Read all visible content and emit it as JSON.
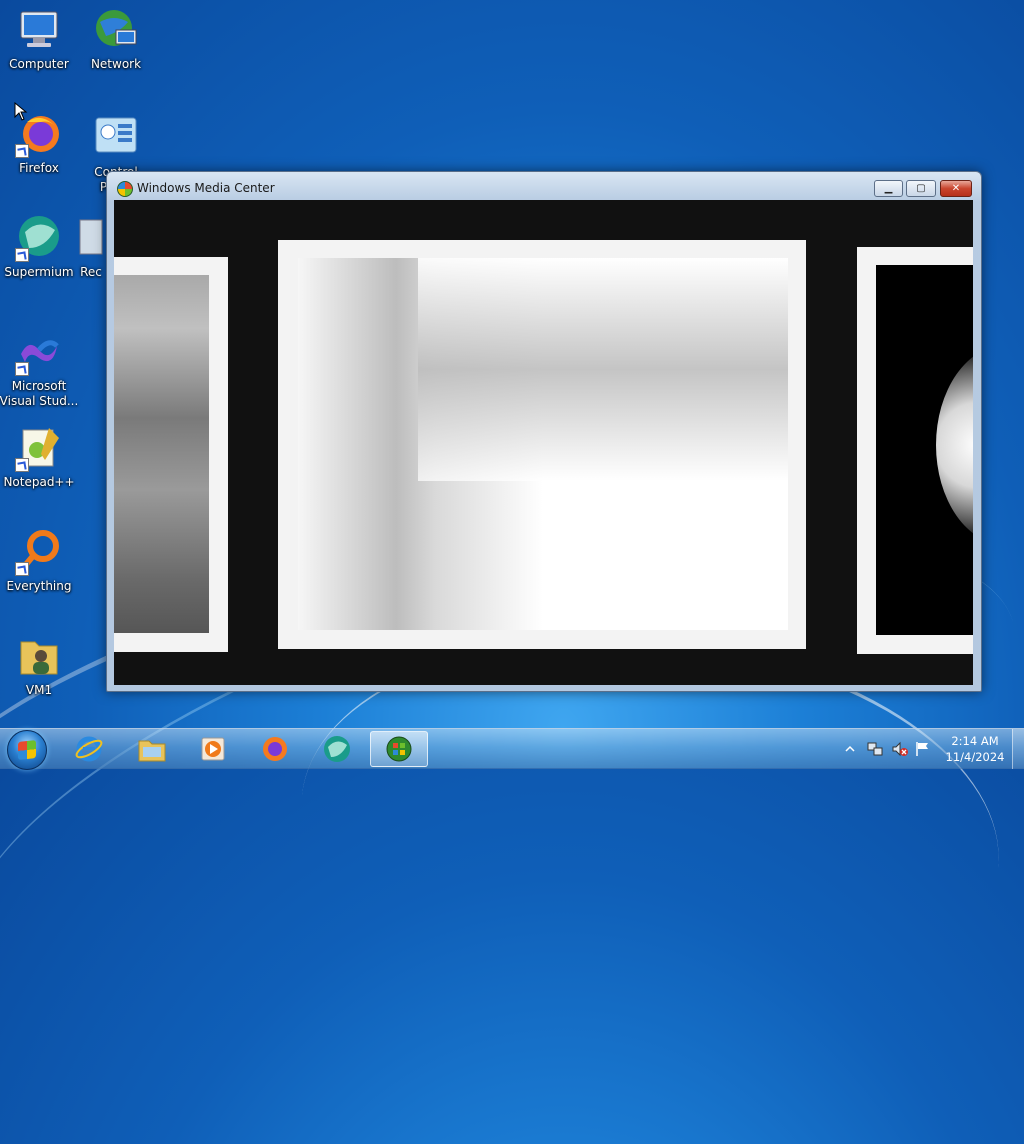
{
  "desktop": {
    "icons": [
      {
        "label": "Computer",
        "icon": "computer-icon"
      },
      {
        "label": "Network",
        "icon": "network-icon"
      },
      {
        "label": "Firefox",
        "icon": "firefox-icon"
      },
      {
        "label": "Control Panel",
        "icon": "control-panel-icon"
      },
      {
        "label": "Supermium",
        "icon": "supermium-icon"
      },
      {
        "label": "Rec",
        "icon": "recycle-bin-icon"
      },
      {
        "label": "Microsoft Visual Stud...",
        "icon": "visual-studio-icon"
      },
      {
        "label": "Notepad++",
        "icon": "notepadpp-icon"
      },
      {
        "label": "Everything",
        "icon": "everything-icon"
      },
      {
        "label": "VM1",
        "icon": "folder-user-icon"
      }
    ]
  },
  "window": {
    "title": "Windows Media Center",
    "buttons": {
      "minimize": "▁",
      "maximize": "▢",
      "close": "✕"
    }
  },
  "taskbar": {
    "items": [
      {
        "name": "internet-explorer",
        "icon": "ie-icon",
        "active": false
      },
      {
        "name": "windows-explorer",
        "icon": "folder-icon",
        "active": false
      },
      {
        "name": "media-player",
        "icon": "media-player-icon",
        "active": false
      },
      {
        "name": "firefox",
        "icon": "firefox-icon",
        "active": false
      },
      {
        "name": "supermium",
        "icon": "supermium-icon",
        "active": false
      },
      {
        "name": "windows-media-center",
        "icon": "media-center-icon",
        "active": true
      }
    ],
    "tray": {
      "time": "2:14 AM",
      "date": "11/4/2024"
    }
  },
  "colors": {
    "desktop_blue": "#0f5fb8",
    "close_red": "#c9452e",
    "content_black": "#111111"
  }
}
